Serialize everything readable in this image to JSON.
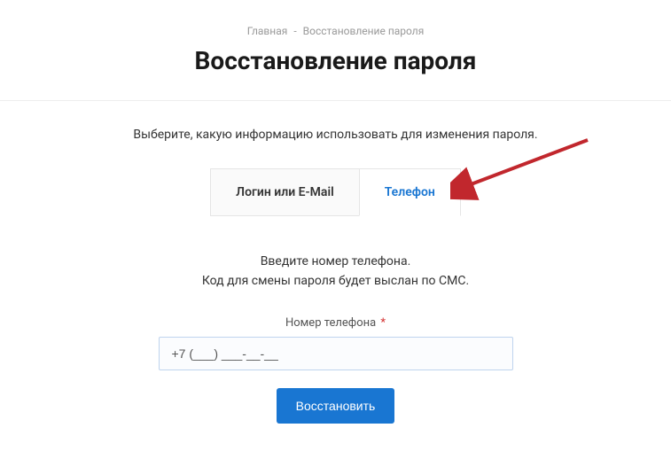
{
  "breadcrumb": {
    "home": "Главная",
    "separator": "-",
    "current": "Восстановление пароля"
  },
  "title": "Восстановление пароля",
  "instruction": "Выберите, какую информацию использовать для изменения пароля.",
  "tabs": {
    "login": "Логин или E-Mail",
    "phone": "Телефон"
  },
  "form": {
    "line1": "Введите номер телефона.",
    "line2": "Код для смены пароля будет выслан по СМС.",
    "label": "Номер телефона",
    "required_mark": "*",
    "input_value": "+7 (___) ___-__-__",
    "submit": "Восстановить"
  },
  "colors": {
    "accent": "#1976d2",
    "arrow": "#c1272d"
  }
}
